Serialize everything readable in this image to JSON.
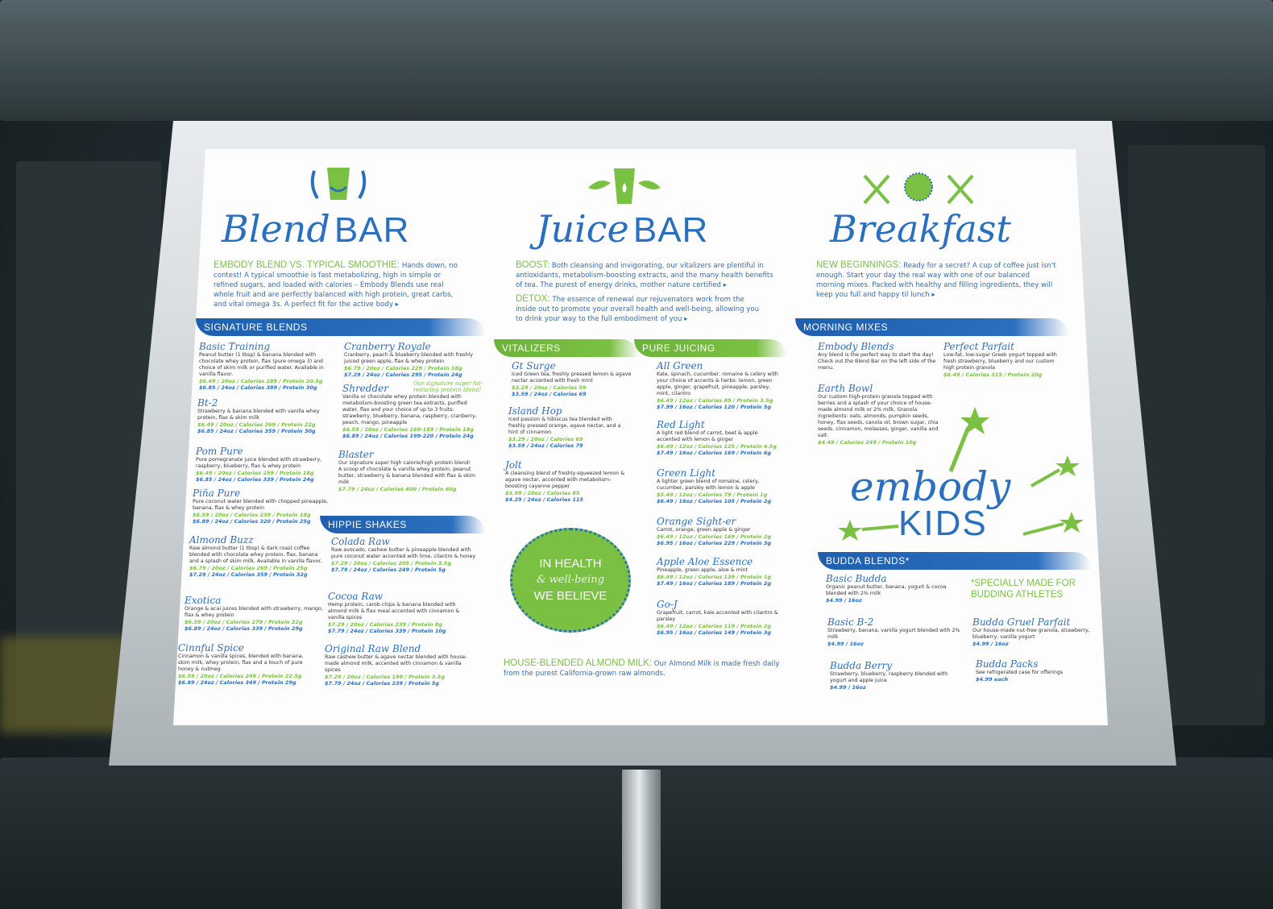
{
  "colors": {
    "brand_blue": "#2b6fbf",
    "brand_green": "#7ac143"
  },
  "blend": {
    "title_script": "Blend",
    "title_bar": "BAR",
    "intro_lead": "EMBODY BLEND VS. TYPICAL SMOOTHIE:",
    "intro_text": "Hands down, no contest! A typical smoothie is fast metabolizing, high in simple or refined sugars, and loaded with calories – Embody Blends use real whole fruit and are perfectly balanced with high protein, great carbs, and vital omega 3s. A perfect fit for the active body ▸",
    "band": "SIGNATURE BLENDS",
    "items": [
      {
        "name": "Basic Training",
        "desc": "Peanut butter (1 tbsp) & banana blended with chocolate whey protein, flax (pure omega 3) and choice of skim milk or purified water. Available in vanilla flavor.",
        "p1": "$6.49 / 20oz / Calories 289 / Protein 20.5g",
        "p2": "$6.85 / 24oz / Calories 389 / Protein 30g"
      },
      {
        "name": "Bt-2",
        "desc": "Strawberry & banana blended with vanilla whey protein, flax & skim milk",
        "p1": "$6.49 / 20oz / Calories 269 / Protein 22g",
        "p2": "$6.85 / 24oz / Calories 359 / Protein 30g"
      },
      {
        "name": "Pom Pure",
        "desc": "Pure pomegranate juice blended with strawberry, raspberry, blueberry, flax & whey protein",
        "p1": "$6.49 / 20oz / Calories 259 / Protein 18g",
        "p2": "$6.85 / 24oz / Calories 339 / Protein 24g"
      },
      {
        "name": "Piña Pure",
        "desc": "Pure coconut water blended with chopped pineapple, banana, flax & whey protein",
        "p1": "$6.59 / 20oz / Calories 239 / Protein 18g",
        "p2": "$6.89 / 24oz / Calories 320 / Protein 25g"
      },
      {
        "name": "Almond Buzz",
        "desc": "Raw almond butter (1 tbsp) & dark roast coffee blended with chocolate whey protein, flax, banana and a splash of skim milk. Available in vanilla flavor.",
        "p1": "$6.79 / 20oz / Calories 269 / Protein 25g",
        "p2": "$7.29 / 24oz / Calories 359 / Protein 32g"
      },
      {
        "name": "Exotica",
        "desc": "Orange & acai juices blended with strawberry, mango, flax & whey protein",
        "p1": "$6.59 / 20oz / Calories 279 / Protein 22g",
        "p2": "$6.89 / 24oz / Calories 339 / Protein 29g"
      },
      {
        "name": "Cinnful Spice",
        "desc": "Cinnamon & vanilla spices, blended with banana, skim milk, whey protein, flax and a touch of pure honey & nutmeg",
        "p1": "$6.59 / 20oz / Calories 249 / Protein 22.5g",
        "p2": "$6.89 / 24oz / Calories 349 / Protein 29g"
      }
    ],
    "items_col2": [
      {
        "name": "Cranberry Royale",
        "desc": "Cranberry, peach & blueberry blended with freshly juiced green apple, flax & whey protein",
        "p1": "$6.79 / 20oz / Calories 229 / Protein 18g",
        "p2": "$7.29 / 24oz / Calories 295 / Protein 24g"
      },
      {
        "name": "Shredder",
        "desc": "Vanilla or chocolate whey protein blended with metabolism-boosting green tea extracts, purified water, flax and your choice of up to 3 fruits: strawberry, blueberry, banana, raspberry, cranberry, peach, mango, pineapple",
        "p1": "$6.59 / 20oz / Calories 169-189 / Protein 18g",
        "p2": "$6.89 / 24oz / Calories 199-220 / Protein 24g"
      },
      {
        "name": "Blaster",
        "desc": "Our signature super high calorie/high protein blend! A scoop of chocolate & vanilla whey protein, peanut butter, strawberry & banana blended with flax & skim milk",
        "p1": "$7.79 / 24oz / Calories 600 / Protein 60g",
        "p2": ""
      }
    ],
    "shredder_note": "Our signature super fat-reducing protein blend!",
    "hippie_band": "HIPPIE SHAKES",
    "hippie": [
      {
        "name": "Colada Raw",
        "desc": "Raw avocado, cashew butter & pineapple blended with pure coconut water accented with lime, cilantro & honey",
        "p1": "$7.29 / 20oz / Calories 205 / Protein 3.5g",
        "p2": "$7.79 / 24oz / Calories 249 / Protein 5g"
      },
      {
        "name": "Cocoa Raw",
        "desc": "Hemp protein, carob chips & banana blended with almond milk & flax meal accented with cinnamon & vanilla spices",
        "p1": "$7.29 / 20oz / Calories 239 / Protein 8g",
        "p2": "$7.79 / 24oz / Calories 339 / Protein 10g"
      },
      {
        "name": "Original Raw Blend",
        "desc": "Raw cashew butter & agave nectar blended with house-made almond milk, accented with cinnamon & vanilla spices",
        "p1": "$7.29 / 20oz / Calories 199 / Protein 3.5g",
        "p2": "$7.79 / 24oz / Calories 239 / Protein 5g"
      }
    ]
  },
  "juice": {
    "title_script": "Juice",
    "title_bar": "BAR",
    "boost_lead": "BOOST:",
    "boost_text": "Both cleansing and invigorating, our vitalizers are plentiful in antioxidants, metabolism-boosting extracts, and the many health benefits of tea. The purest of energy drinks, mother nature certified ▸",
    "detox_lead": "DETOX:",
    "detox_text": "The essence of renewal our rejuvenators work from the inside out to promote your overall health and well-being, allowing you to drink your way to the full embodiment of you ▸",
    "vitalizers_band": "VITALIZERS",
    "pure_band": "PURE JUICING",
    "vitalizers": [
      {
        "name": "Gt Surge",
        "desc": "Iced Green tea, freshly pressed lemon & agave nectar accented with fresh mint",
        "p1": "$3.29 / 20oz / Calories 59",
        "p2": "$3.59 / 24oz / Calories 69"
      },
      {
        "name": "Island Hop",
        "desc": "Iced passion & hibiscus tea blended with freshly pressed orange, agave nectar, and a hint of cinnamon",
        "p1": "$3.29 / 20oz / Calories 69",
        "p2": "$3.59 / 24oz / Calories 79"
      },
      {
        "name": "Jolt",
        "desc": "A cleansing blend of freshly-squeezed lemon & agave nectar, accented with metabolism-boosting cayenne pepper",
        "p1": "$3.99 / 20oz / Calories 85",
        "p2": "$4.29 / 24oz / Calories 115"
      }
    ],
    "pure": [
      {
        "name": "All Green",
        "desc": "Kale, spinach, cucumber, romaine & celery with your choice of accents & herbs: lemon, green apple, ginger, grapefruit, pineapple, parsley, mint, cilantro",
        "p1": "$6.49 / 12oz / Calories 89 / Protein 3.5g",
        "p2": "$7.99 / 16oz / Calories 120 / Protein 5g"
      },
      {
        "name": "Red Light",
        "desc": "A light red blend of carrot, beet & apple accented with lemon & ginger",
        "p1": "$6.49 / 12oz / Calories 125 / Protein 4.5g",
        "p2": "$7.49 / 16oz / Calories 169 / Protein 6g"
      },
      {
        "name": "Green Light",
        "desc": "A lighter green blend of romaine, celery, cucumber, parsley with lemon & apple",
        "p1": "$5.49 / 12oz / Calories 79 / Protein 1g",
        "p2": "$6.49 / 16oz / Calories 105 / Protein 2g"
      },
      {
        "name": "Orange Sight-er",
        "desc": "Carrot, orange, green apple & ginger",
        "p1": "$6.49 / 12oz / Calories 169 / Protein 2g",
        "p2": "$6.95 / 16oz / Calories 229 / Protein 3g"
      },
      {
        "name": "Apple Aloe Essence",
        "desc": "Pineapple, green apple, aloe & mint",
        "p1": "$6.49 / 12oz / Calories 139 / Protein 1g",
        "p2": "$7.49 / 16oz / Calories 189 / Protein 2g"
      },
      {
        "name": "Go-J",
        "desc": "Grapefruit, carrot, kale accented with cilantro & parsley",
        "p1": "$6.49 / 12oz / Calories 119 / Protein 2g",
        "p2": "$6.95 / 16oz / Calories 149 / Protein 3g"
      }
    ],
    "badge_line1": "IN HEALTH",
    "badge_script": "& well-being",
    "badge_line2": "WE BELIEVE",
    "almond_lead": "HOUSE-BLENDED ALMOND MILK:",
    "almond_text": "Our Almond Milk is made fresh daily from the purest California-grown raw almonds."
  },
  "breakfast": {
    "title_script": "Breakfast",
    "intro_lead": "NEW BEGINNINGS:",
    "intro_text": "Ready for a secret? A cup of coffee just isn't enough. Start your day the real way with one of our balanced morning mixes. Packed with healthy and filling ingredients, they will keep you full and happy til lunch ▸",
    "band": "MORNING MIXES",
    "items": [
      {
        "name": "Embody Blends",
        "desc": "Any blend is the perfect way to start the day! Check out the Blend Bar on the left side of the menu.",
        "p1": "",
        "p2": ""
      },
      {
        "name": "Earth Bowl",
        "desc": "Our custom high-protein granola topped with berries and a splash of your choice of house-made almond milk or 2% milk. Granola ingredients: oats, almonds, pumpkin seeds, honey, flax seeds, canola oil, brown sugar, chia seeds, cinnamon, molasses, ginger, vanilla and salt.",
        "p1": "$4.49 / Calories 249 / Protein 10g",
        "p2": ""
      },
      {
        "name": "Perfect Parfait",
        "desc": "Low-fat, low-sugar Greek yogurt topped with fresh strawberry, blueberry and our custom high protein granola",
        "p1": "$6.49 / Calories 315 / Protein 20g",
        "p2": ""
      }
    ],
    "kids_script": "embody",
    "kids_word": "KIDS",
    "budda_band": "BUDDA BLENDS*",
    "note": "*SPECIALLY MADE FOR BUDDING ATHLETES",
    "kids": [
      {
        "name": "Basic Budda",
        "desc": "Organic peanut butter, banana, yogurt & cocoa blended with 2% milk",
        "p1": "",
        "p2": "$4.99 / 16oz"
      },
      {
        "name": "Basic B-2",
        "desc": "Strawberry, banana, vanilla yogurt blended with 2% milk",
        "p1": "",
        "p2": "$4.99 / 16oz"
      },
      {
        "name": "Budda Berry",
        "desc": "Strawberry, blueberry, raspberry blended with yogurt and apple juice",
        "p1": "",
        "p2": "$4.99 / 16oz"
      },
      {
        "name": "Budda Gruel Parfait",
        "desc": "Our house-made nut-free granola, strawberry, blueberry, vanilla yogurt",
        "p1": "",
        "p2": "$4.99 / 16oz"
      },
      {
        "name": "Budda Packs",
        "desc": "See refrigerated case for offerings",
        "p1": "",
        "p2": "$4.99 each"
      }
    ]
  }
}
